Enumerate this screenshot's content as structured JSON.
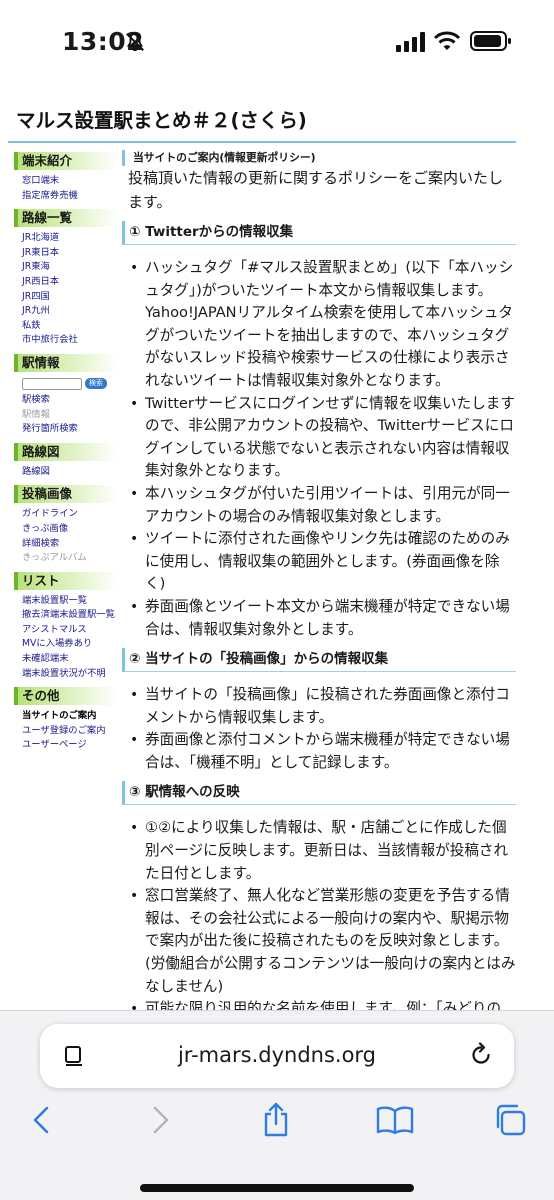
{
  "status": {
    "time": "13:02"
  },
  "page": {
    "title": "マルス設置駅まとめ＃２(さくら)"
  },
  "sidebar": {
    "sections": [
      {
        "heading": "端末紹介",
        "items": [
          "窓口端末",
          "指定席券売機"
        ]
      },
      {
        "heading": "路線一覧",
        "items": [
          "JR北海道",
          "JR東日本",
          "JR東海",
          "JR西日本",
          "JR四国",
          "JR九州",
          "私鉄",
          "市中旅行会社"
        ]
      },
      {
        "heading": "駅情報",
        "search_button": "検索",
        "items": [
          "駅検索",
          "駅情報",
          "発行箇所検索"
        ]
      },
      {
        "heading": "路線図",
        "items": [
          "路線図"
        ]
      },
      {
        "heading": "投稿画像",
        "items": [
          "ガイドライン",
          "きっぷ画像",
          "詳細検索",
          "きっぷアルバム"
        ]
      },
      {
        "heading": "リスト",
        "items": [
          "端末設置駅一覧",
          "撤去済端末設置駅一覧",
          "アシストマルス",
          "MVに入場券あり",
          "未確認端末",
          "端末設置状況が不明"
        ]
      },
      {
        "heading": "その他",
        "items": [
          "当サイトのご案内",
          "ユーザ登録のご案内",
          "ユーザーページ"
        ]
      }
    ]
  },
  "main": {
    "notice_heading": "当サイトのご案内(情報更新ポリシー)",
    "intro": "投稿頂いた情報の更新に関するポリシーをご案内いたします。",
    "sections": [
      {
        "heading": "① Twitterからの情報収集",
        "bullets": [
          "ハッシュタグ「#マルス設置駅まとめ」(以下「本ハッシュタグ」)がついたツイート本文から情報収集します。Yahoo!JAPANリアルタイム検索を使用して本ハッシュタグがついたツイートを抽出しますので、本ハッシュタグがないスレッド投稿や検索サービスの仕様により表示されないツイートは情報収集対象外となります。",
          "Twitterサービスにログインせずに情報を収集いたしますので、非公開アカウントの投稿や、Twitterサービスにログインしている状態でないと表示されない内容は情報収集対象外となります。",
          "本ハッシュタグが付いた引用ツイートは、引用元が同一アカウントの場合のみ情報収集対象とします。",
          "ツイートに添付された画像やリンク先は確認のためのみに使用し、情報収集の範囲外とします。(券面画像を除く)",
          "券面画像とツイート本文から端末機種が特定できない場合は、情報収集対象外とします。"
        ]
      },
      {
        "heading": "② 当サイトの「投稿画像」からの情報収集",
        "bullets": [
          "当サイトの「投稿画像」に投稿された券面画像と添付コメントから情報収集します。",
          "券面画像と添付コメントから端末機種が特定できない場合は、「機種不明」として記録します。"
        ]
      },
      {
        "heading": "③ 駅情報への反映",
        "bullets": [
          "①②により収集した情報は、駅・店舗ごとに作成した個別ページに反映します。更新日は、当該情報が投稿された日付とします。",
          "窓口営業終了、無人化など営業形態の変更を予告する情報は、その会社公式による一般向けの案内や、駅掲示物で案内が出た後に投稿されたものを反映対象とします。(労働組合が公開するコンテンツは一般向けの案内とはみなしません)",
          "可能な限り汎用的な名前を使用します。例：「みどりの"
        ]
      }
    ]
  },
  "browser": {
    "url": "jr-mars.dyndns.org"
  },
  "colors": {
    "accent_blue": "#7ec3e4",
    "sidebar_green": "#b9e27a",
    "ios_blue": "#2f7de1"
  }
}
